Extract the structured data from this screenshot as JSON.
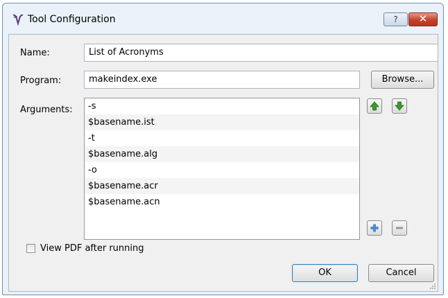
{
  "window": {
    "title": "Tool Configuration",
    "help_glyph": "?",
    "close_glyph": "✕"
  },
  "form": {
    "name_label": "Name:",
    "name_value": "List of Acronyms",
    "program_label": "Program:",
    "program_value": "makeindex.exe",
    "browse_label": "Browse...",
    "arguments_label": "Arguments:",
    "arguments": [
      "-s",
      "$basename.ist",
      "-t",
      "$basename.alg",
      "-o",
      "$basename.acr",
      "$basename.acn"
    ],
    "view_pdf_label": "View PDF after running",
    "view_pdf_checked": false
  },
  "buttons": {
    "ok_label": "OK",
    "cancel_label": "Cancel"
  },
  "icons": {
    "move_up": "green-up-arrow-icon",
    "move_down": "green-down-arrow-icon",
    "add": "plus-icon",
    "remove": "minus-icon"
  },
  "colors": {
    "arrow_green": "#3a9a2a",
    "plus_blue": "#4a8ad0",
    "close_red": "#c5412c"
  }
}
